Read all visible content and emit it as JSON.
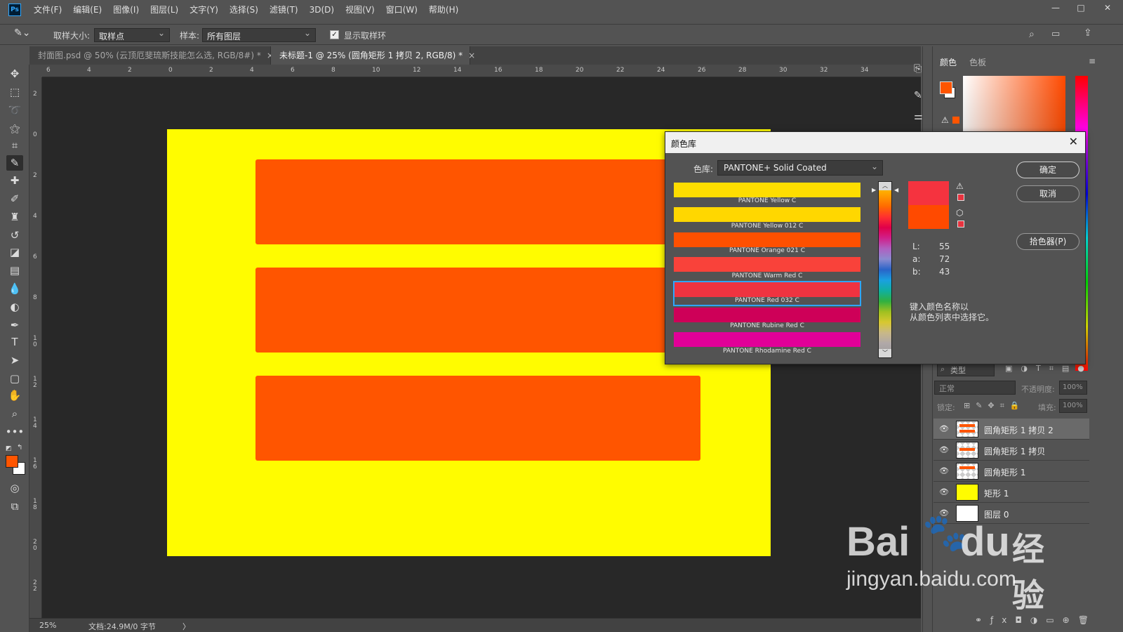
{
  "app": {
    "logo": "Ps",
    "menu": [
      "文件(F)",
      "编辑(E)",
      "图像(I)",
      "图层(L)",
      "文字(Y)",
      "选择(S)",
      "滤镜(T)",
      "3D(D)",
      "视图(V)",
      "窗口(W)",
      "帮助(H)"
    ],
    "window_controls": [
      "—",
      "□",
      "✕"
    ]
  },
  "options": {
    "sample_size_label": "取样大小:",
    "sample_size_value": "取样点",
    "sample_label": "样本:",
    "sample_value": "所有图层",
    "show_ring_label": "显示取样环",
    "show_ring_checked": true
  },
  "tabs": [
    {
      "label": "封面图.psd @ 50% (云顶厄斐琉斯技能怎么选, RGB/8#) *",
      "close": "×",
      "active": false
    },
    {
      "label": "未标题-1 @ 25% (圆角矩形 1 拷贝 2, RGB/8) *",
      "close": "×",
      "active": true
    }
  ],
  "ruler_h": [
    "6",
    "4",
    "2",
    "0",
    "2",
    "4",
    "6",
    "8",
    "10",
    "12",
    "14",
    "16",
    "18",
    "20",
    "22",
    "24",
    "26",
    "28",
    "30",
    "32",
    "34"
  ],
  "ruler_v": [
    "2",
    "0",
    "2",
    "4",
    "6",
    "8",
    "1\n0",
    "1\n2",
    "1\n4",
    "1\n6",
    "1\n8",
    "2\n0",
    "2\n2"
  ],
  "colors": {
    "artboard": "#fffc00",
    "bars": "#ff5500",
    "foreground": "#ff5500",
    "background": "#ffffff",
    "accent_select": "#2ea6ff"
  },
  "status": {
    "zoom": "25%",
    "doc": "文档:24.9M/0 字节",
    "arrow": "〉"
  },
  "right_panel": {
    "tab_color": "颜色",
    "tab_swatches": "色板",
    "layers": {
      "kind_label": "类型",
      "blend_mode": "正常",
      "opacity_label": "不透明度:",
      "opacity_value": "100%",
      "lock_label": "锁定:",
      "fill_label": "填充:",
      "fill_value": "100%",
      "items": [
        {
          "name": "圆角矩形 1 拷贝 2",
          "selected": true,
          "thumb": "bar"
        },
        {
          "name": "圆角矩形 1 拷贝",
          "selected": false,
          "thumb": "bar"
        },
        {
          "name": "圆角矩形 1",
          "selected": false,
          "thumb": "bar"
        },
        {
          "name": "矩形 1",
          "selected": false,
          "thumb": "yellow"
        },
        {
          "name": "图层 0",
          "selected": false,
          "thumb": "white"
        }
      ]
    }
  },
  "dialog": {
    "title": "颜色库",
    "close": "✕",
    "library_label": "色库:",
    "library_value": "PANTONE+ Solid Coated",
    "ok": "确定",
    "cancel": "取消",
    "picker": "拾色器(P)",
    "L_label": "L:",
    "L_value": "55",
    "a_label": "a:",
    "a_value": "72",
    "b_label": "b:",
    "b_value": "43",
    "hint_line1": "键入颜色名称以",
    "hint_line2": "从颜色列表中选择它。",
    "new_color": "#f5333f",
    "old_color": "#ff4a00",
    "swatches": [
      {
        "name": "PANTONE Yellow C",
        "color": "#fedd00"
      },
      {
        "name": "PANTONE Yellow 012 C",
        "color": "#ffd700"
      },
      {
        "name": "PANTONE Orange 021 C",
        "color": "#fe5000"
      },
      {
        "name": "PANTONE Warm Red C",
        "color": "#f9423a"
      },
      {
        "name": "PANTONE Red 032 C",
        "color": "#ef3340",
        "selected": true
      },
      {
        "name": "PANTONE Rubine Red C",
        "color": "#ce0058"
      },
      {
        "name": "PANTONE Rhodamine Red C",
        "color": "#e10098"
      }
    ]
  },
  "watermark": {
    "brand": "Bai",
    "brand2": "du",
    "cn": "经验",
    "url": "jingyan.baidu.com"
  }
}
